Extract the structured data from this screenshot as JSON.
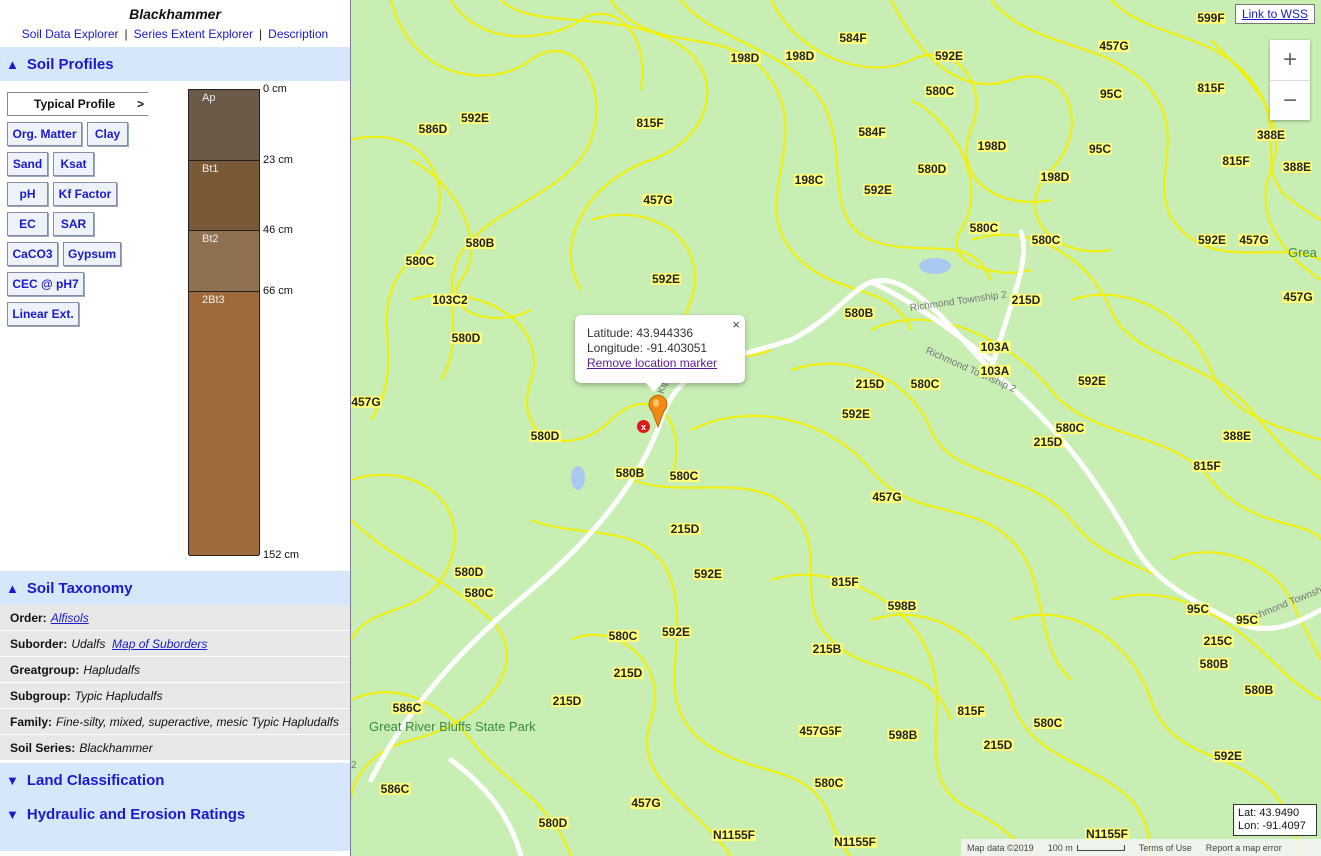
{
  "sidebar": {
    "series_title": "Blackhammer",
    "nav": [
      "Soil Data Explorer",
      "Series Extent Explorer",
      "Description"
    ],
    "profiles_header": "Soil Profiles",
    "typical_profile": "Typical Profile",
    "typical_arrow": ">",
    "property_buttons": [
      "Org. Matter",
      "Clay",
      "Sand",
      "Ksat",
      "pH",
      "Kf Factor",
      "EC",
      "SAR",
      "CaCO3",
      "Gypsum",
      "CEC @ pH7",
      "Linear Ext."
    ],
    "horizons": [
      {
        "name": "Ap",
        "top_cm": 0,
        "bottom_cm": 23,
        "color": "#6b5a48"
      },
      {
        "name": "Bt1",
        "top_cm": 23,
        "bottom_cm": 46,
        "color": "#7a5a36"
      },
      {
        "name": "Bt2",
        "top_cm": 46,
        "bottom_cm": 66,
        "color": "#8f7150"
      },
      {
        "name": "2Bt3",
        "top_cm": 66,
        "bottom_cm": 152,
        "color": "#a06b3c"
      }
    ],
    "depth_labels": [
      "0 cm",
      "23 cm",
      "46 cm",
      "66 cm",
      "152 cm"
    ],
    "taxonomy_header": "Soil Taxonomy",
    "taxonomy": {
      "order_label": "Order:",
      "order_value": "Alfisols",
      "suborder_label": "Suborder:",
      "suborder_value": "Udalfs",
      "suborder_link": "Map of Suborders",
      "greatgroup_label": "Greatgroup:",
      "greatgroup_value": "Hapludalfs",
      "subgroup_label": "Subgroup:",
      "subgroup_value": "Typic Hapludalfs",
      "family_label": "Family:",
      "family_value": "Fine-silty, mixed, superactive, mesic Typic Hapludalfs",
      "series_label": "Soil Series:",
      "series_value": "Blackhammer"
    },
    "land_header": "Land Classification",
    "hydraulic_header": "Hydraulic and Erosion Ratings"
  },
  "map": {
    "wss_link": "Link to WSS",
    "zoom_in": "+",
    "zoom_out": "−",
    "popup": {
      "latitude": "Latitude: 43.944336",
      "longitude": "Longitude: -91.403051",
      "remove": "Remove location marker",
      "close": "×"
    },
    "marker_x": "x",
    "latlon_box": {
      "lat": "Lat: 43.9490",
      "lon": "Lon: -91.4097"
    },
    "attribution": {
      "data": "Map data ©2019",
      "scale": "100 m",
      "terms": "Terms of Use",
      "report": "Report a map error"
    },
    "park_label": "Great River Bluffs State Park",
    "great_label": "Grea",
    "road_names": [
      "Kipp Dr",
      "Richmond Township 2",
      "Richmond Township 2",
      "Richmond Township",
      "2"
    ],
    "soil_units": [
      "599F",
      "457G",
      "584F",
      "592E",
      "198D",
      "198D",
      "95C",
      "815F",
      "580C",
      "586D",
      "592E",
      "815F",
      "584F",
      "198D",
      "95C",
      "388E",
      "580D",
      "198D",
      "815F",
      "388E",
      "198C",
      "592E",
      "457G",
      "580C",
      "580C",
      "592E",
      "457G",
      "580B",
      "580C",
      "215D",
      "457G",
      "592E",
      "103C2",
      "580D",
      "580B",
      "103A",
      "103A",
      "215D",
      "580C",
      "592E",
      "457G",
      "592E",
      "580C",
      "215D",
      "388E",
      "580D",
      "580B",
      "580C",
      "815F",
      "457G",
      "215D",
      "580D",
      "580C",
      "592E",
      "815F",
      "598B",
      "95C",
      "95C",
      "580C",
      "592E",
      "215B",
      "215C",
      "580B",
      "586C",
      "215D",
      "215D",
      "580B",
      "815F",
      "815F",
      "580C",
      "457G",
      "598B",
      "215D",
      "592E",
      "580C",
      "586C",
      "457G",
      "580D",
      "N1155F",
      "N1155F",
      "N1155F",
      "103A",
      "580D"
    ]
  }
}
